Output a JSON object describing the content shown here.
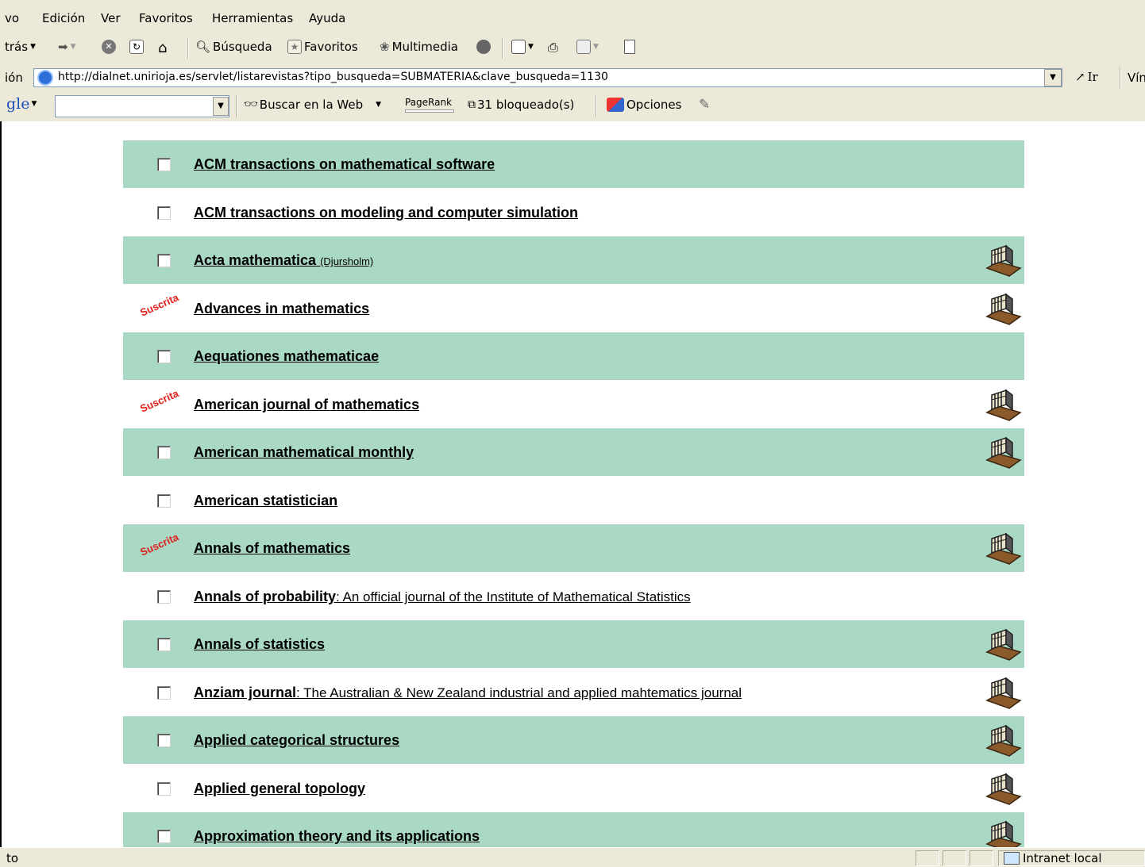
{
  "menu": [
    "vo",
    "Edición",
    "Ver",
    "Favoritos",
    "Herramientas",
    "Ayuda"
  ],
  "toolbar": {
    "back": "trás",
    "search": "Búsqueda",
    "favorites": "Favoritos",
    "media": "Multimedia"
  },
  "address": {
    "label": "ión",
    "url": "http://dialnet.unirioja.es/servlet/listarevistas?tipo_busqueda=SUBMATERIA&clave_busqueda=1130",
    "go": "Ir",
    "links": "Vín"
  },
  "google": {
    "logo": "gle",
    "search_web": "Buscar en la Web",
    "pagerank": "PageRank",
    "blocked": "31 bloqueado(s)",
    "options": "Opciones"
  },
  "journals": [
    {
      "title": "ACM transactions on mathematical software",
      "subtitle": "",
      "note": "",
      "suscrita": false,
      "library": false
    },
    {
      "title": "ACM transactions on modeling and computer simulation",
      "subtitle": "",
      "note": "",
      "suscrita": false,
      "library": false
    },
    {
      "title": "Acta mathematica",
      "subtitle": "",
      "note": "(Djursholm)",
      "suscrita": false,
      "library": true
    },
    {
      "title": "Advances in mathematics",
      "subtitle": "",
      "note": "",
      "suscrita": true,
      "library": true
    },
    {
      "title": "Aequationes mathematicae",
      "subtitle": "",
      "note": "",
      "suscrita": false,
      "library": false
    },
    {
      "title": "American journal of mathematics",
      "subtitle": "",
      "note": "",
      "suscrita": true,
      "library": true
    },
    {
      "title": "American mathematical monthly",
      "subtitle": "",
      "note": "",
      "suscrita": false,
      "library": true
    },
    {
      "title": "American statistician",
      "subtitle": "",
      "note": "",
      "suscrita": false,
      "library": false
    },
    {
      "title": "Annals of mathematics",
      "subtitle": "",
      "note": "",
      "suscrita": true,
      "library": true
    },
    {
      "title": "Annals of probability",
      "subtitle": ": An official journal of the Institute of Mathematical Statistics",
      "note": "",
      "suscrita": false,
      "library": false
    },
    {
      "title": "Annals of statistics",
      "subtitle": "",
      "note": "",
      "suscrita": false,
      "library": true
    },
    {
      "title": "Anziam journal",
      "subtitle": ": The Australian & New Zealand industrial and applied mahtematics journal",
      "note": "",
      "suscrita": false,
      "library": true
    },
    {
      "title": "Applied categorical structures",
      "subtitle": "",
      "note": "",
      "suscrita": false,
      "library": true
    },
    {
      "title": "Applied general topology",
      "subtitle": "",
      "note": "",
      "suscrita": false,
      "library": true
    },
    {
      "title": "Approximation theory and its applications",
      "subtitle": "",
      "note": "",
      "suscrita": false,
      "library": true
    }
  ],
  "suscrita_label": "Suscrita",
  "status": {
    "left": "to",
    "zone": "Intranet local"
  },
  "colors": {
    "row_green": "#a9d8c4",
    "suscrita": "#e0201c",
    "chrome": "#ece9d8"
  }
}
